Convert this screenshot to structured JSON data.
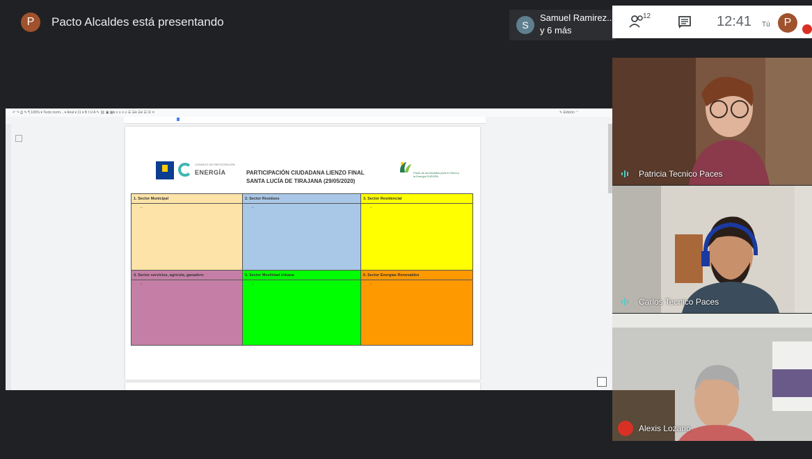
{
  "presenter": {
    "avatar_letter": "P",
    "label": "Pacto Alcaldes está presentando"
  },
  "participants_chip": {
    "avatar_letter": "S",
    "name": "Samuel Ramirez...",
    "more": "y 6 más"
  },
  "top_controls": {
    "people_count": "12",
    "clock": "12:41",
    "you_label": "Tú",
    "self_avatar_letter": "P"
  },
  "document": {
    "toolbar_text": "↶  ↷  ⎙  ✎  ¶   100%  ▾   Texto norm...  ▾   Arial   ▾   11  ▾   B  I  U  A  ✎   ⛓  ▣  ▦▾   ≡  ≡  ≡  ≡   ☰  ☰▾  ☰▾  ☰  ☒  ✕",
    "toolbar_right": "✎ Edición   ⌃",
    "logo_energia_small": "CONSEJO DE PARTICIPACIÓN",
    "logo_energia_text": "ENERGÍA",
    "title_line_1": "PARTICIPACIÓN CIUDADANA LIENZO FINAL",
    "title_line_2": "SANTA LUCÍA DE TIRAJANA (29/05/2020)",
    "logo_pacto_text": "Pacto de los Alcaldes para el Clima y la Energía EUROPA",
    "cells": [
      {
        "label": "1. Sector Municipal",
        "dash": "-",
        "color": "#fde3a7"
      },
      {
        "label": "2. Sector Residuos",
        "dash": "-",
        "color": "#a9c7e6"
      },
      {
        "label": "3. Sector Residencial",
        "dash": "-",
        "color": "#ffff00"
      },
      {
        "label": "4. Sector servicios, agrícola, ganadero",
        "dash": "-",
        "color": "#c57fa6"
      },
      {
        "label": "5. Sector Movilidad Urbana",
        "dash": "-",
        "color": "#00ff00"
      },
      {
        "label": "6. Sector Energías Renovables",
        "dash": "-",
        "color": "#ff9900"
      }
    ]
  },
  "tiles": [
    {
      "name": "Patricia Tecnico Paces"
    },
    {
      "name": "Carlos Tecnico Paces"
    },
    {
      "name": "Alexis Lozano"
    }
  ],
  "colors": {
    "meet_dark": "#202124",
    "mute_red": "#d93025",
    "speaking_teal": "#4ecdc4"
  }
}
